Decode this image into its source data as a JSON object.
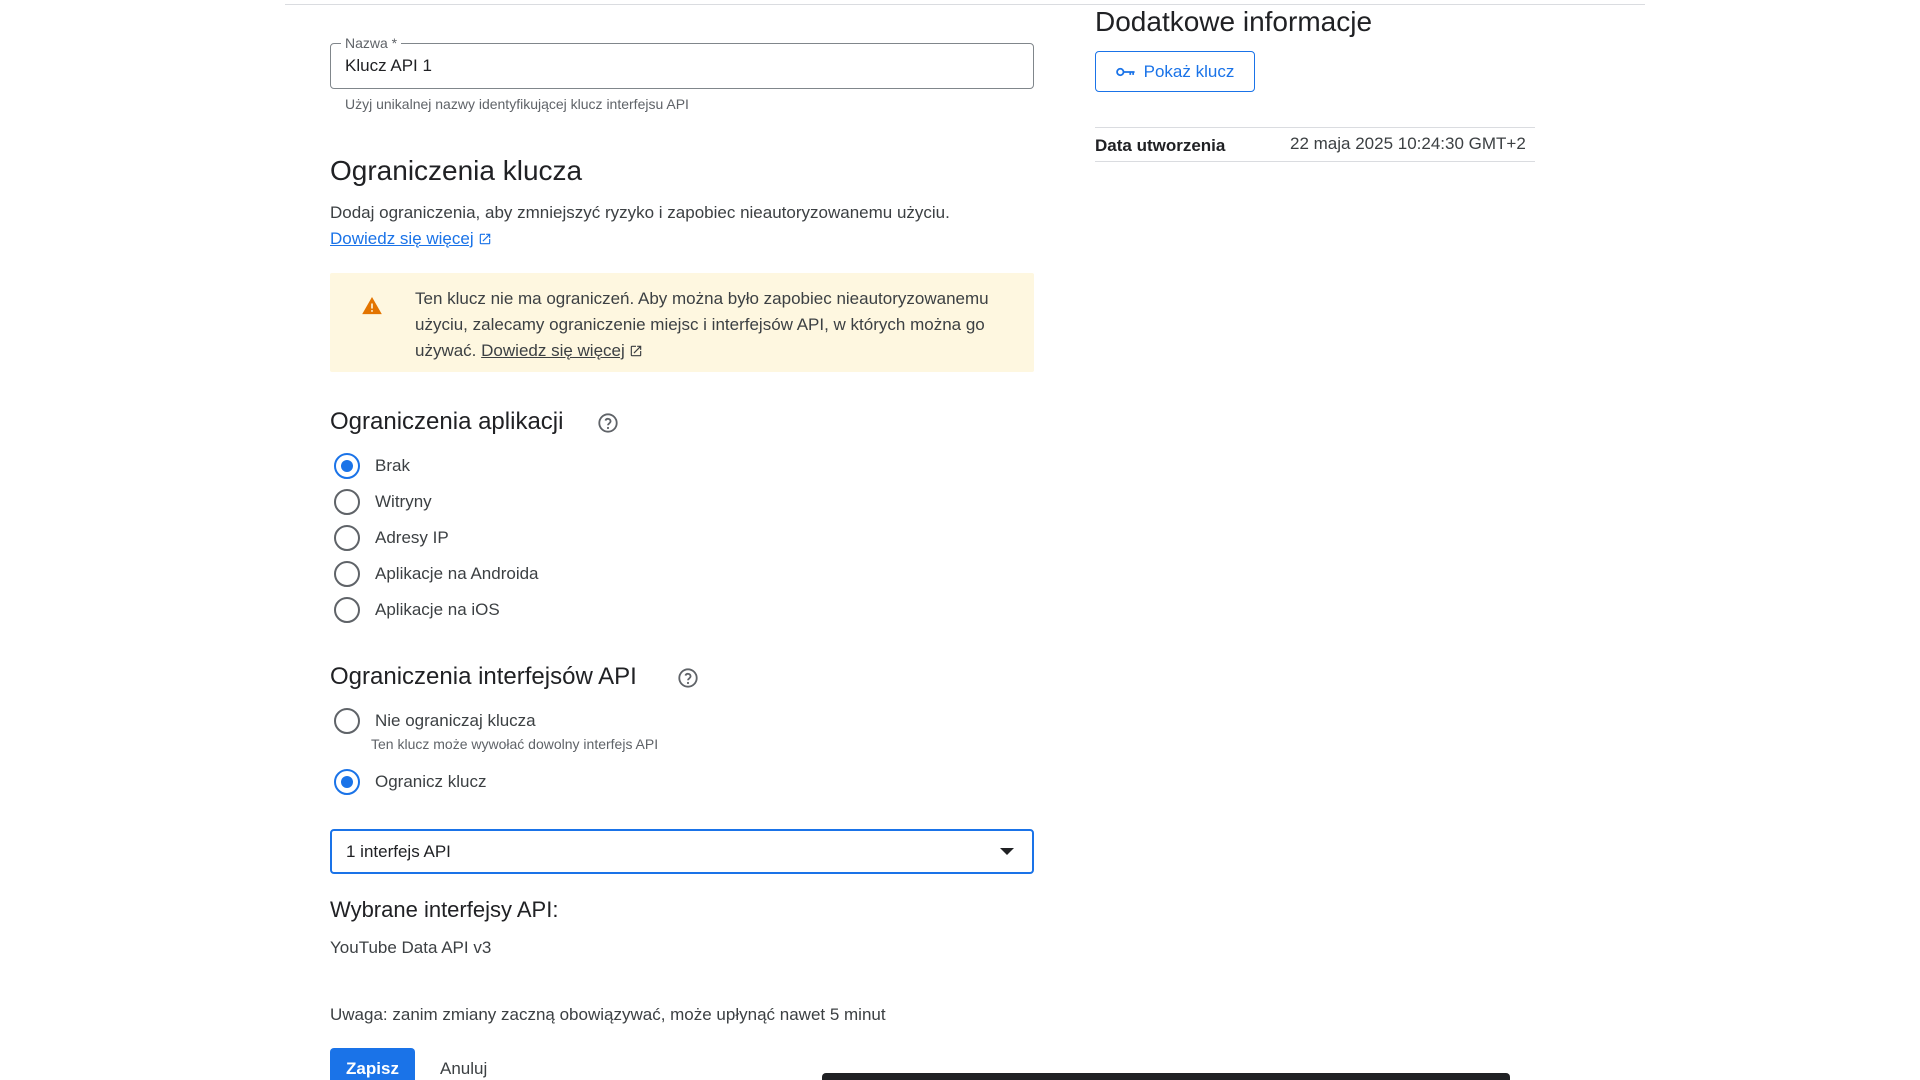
{
  "name_field": {
    "label": "Nazwa *",
    "value": "Klucz API 1",
    "hint": "Użyj unikalnej nazwy identyfikującej klucz interfejsu API"
  },
  "key_restrictions": {
    "title": "Ograniczenia klucza",
    "description": "Dodaj ograniczenia, aby zmniejszyć ryzyko i zapobiec nieautoryzowanemu użyciu.",
    "learn_more": "Dowiedz się więcej"
  },
  "warning": {
    "icon": "warning-icon",
    "text": "Ten klucz nie ma ograniczeń. Aby można było zapobiec nieautoryzowanemu użyciu, zalecamy ograniczenie miejsc i interfejsów API, w których można go używać.",
    "link": "Dowiedz się więcej",
    "color": "#fef7e0"
  },
  "app_restrictions": {
    "title": "Ograniczenia aplikacji",
    "options": [
      {
        "label": "Brak",
        "checked": true
      },
      {
        "label": "Witryny",
        "checked": false
      },
      {
        "label": "Adresy IP",
        "checked": false
      },
      {
        "label": "Aplikacje na Androida",
        "checked": false
      },
      {
        "label": "Aplikacje na iOS",
        "checked": false
      }
    ]
  },
  "api_restrictions": {
    "title": "Ograniczenia interfejsów API",
    "options": [
      {
        "label": "Nie ograniczaj klucza",
        "sublabel": "Ten klucz może wywołać dowolny interfejs API",
        "checked": false
      },
      {
        "label": "Ogranicz klucz",
        "checked": true
      }
    ],
    "select_value": "1 interfejs API"
  },
  "selected_apis": {
    "title": "Wybrane interfejsy API:",
    "items": [
      "YouTube Data API v3"
    ]
  },
  "notice": "Uwaga: zanim zmiany zaczną obowiązywać, może upłynąć nawet 5 minut",
  "actions": {
    "save": "Zapisz",
    "cancel": "Anuluj"
  },
  "additional_info": {
    "title": "Dodatkowe informacje",
    "show_key": "Pokaż klucz",
    "created_label": "Data utworzenia",
    "created_value": "22 maja 2025 10:24:30 GMT+2"
  },
  "colors": {
    "accent": "#1a73e8",
    "warning_icon": "#e37400"
  }
}
